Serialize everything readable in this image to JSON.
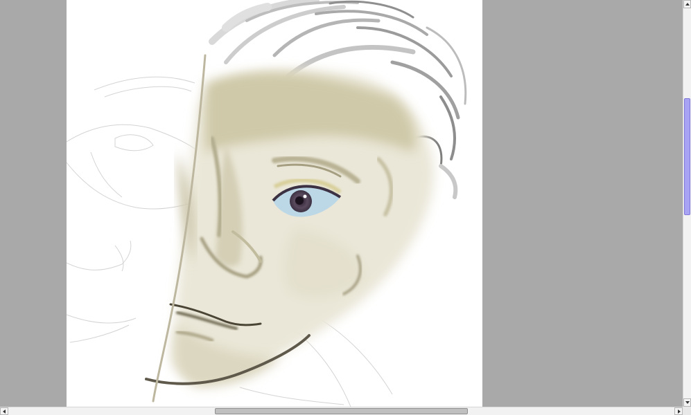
{
  "colors": {
    "workspace": "#a9a9a9",
    "canvas": "#ffffff",
    "skin_shadow": "#c9c3a6",
    "hair_stroke": "#8d8d8d",
    "iris": "#5a4a5e",
    "eye_white": "#bcd8e6",
    "scroll_thumb_vertical": "#a8a3f2",
    "scroll_thumb_horizontal": "#bfbfbf"
  },
  "icons": {
    "scroll_up": "triangle-up-icon",
    "scroll_down": "triangle-down-icon",
    "scroll_left": "triangle-left-icon",
    "scroll_right": "triangle-right-icon"
  },
  "scrollbars": {
    "vertical": {
      "position": 0.33,
      "visible_fraction": 0.3
    },
    "horizontal": {
      "position": 0.5,
      "visible_fraction": 0.38
    }
  }
}
